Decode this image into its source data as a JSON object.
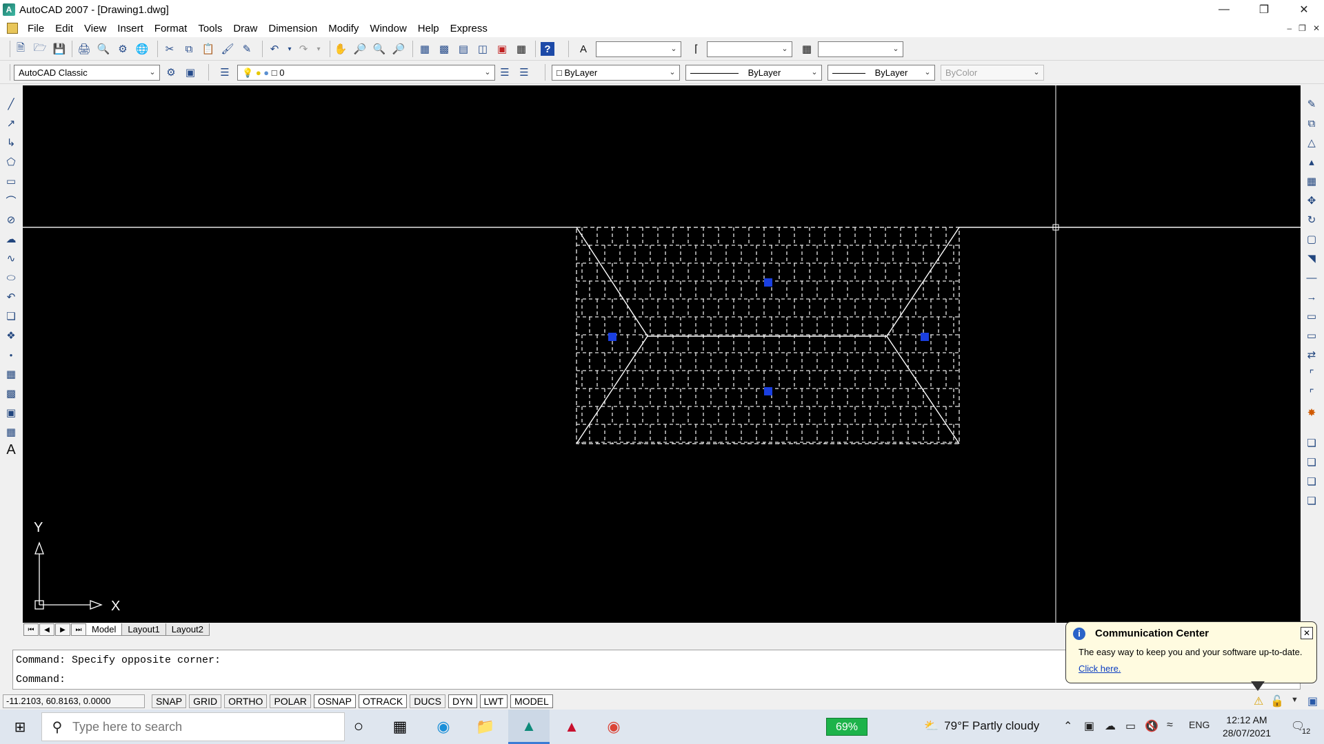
{
  "window": {
    "title": "AutoCAD 2007 - [Drawing1.dwg]",
    "minimize_icon": "minimize-icon",
    "restore_icon": "restore-icon",
    "close_icon": "close-icon"
  },
  "menu": {
    "items": [
      "File",
      "Edit",
      "View",
      "Insert",
      "Format",
      "Tools",
      "Draw",
      "Dimension",
      "Modify",
      "Window",
      "Help",
      "Express"
    ]
  },
  "toolbar2": {
    "workspace": "AutoCAD Classic",
    "layer": "0",
    "color": "ByLayer",
    "linetype": "ByLayer",
    "lineweight": "ByLayer",
    "plotstyle": "ByColor"
  },
  "tabs": {
    "items": [
      "Model",
      "Layout1",
      "Layout2"
    ],
    "active": "Model"
  },
  "command": {
    "line1": "Command: Specify opposite corner:",
    "line2": "Command:"
  },
  "status": {
    "coords": "-11.2103, 60.8163, 0.0000",
    "buttons": [
      "SNAP",
      "GRID",
      "ORTHO",
      "POLAR",
      "OSNAP",
      "OTRACK",
      "DUCS",
      "DYN",
      "LWT",
      "MODEL"
    ],
    "on": [
      "OSNAP",
      "OTRACK",
      "DYN",
      "LWT",
      "MODEL"
    ]
  },
  "comm_center": {
    "title": "Communication Center",
    "message": "The easy way to keep you and your software up-to-date.",
    "link": "Click here."
  },
  "ucs": {
    "x_label": "X",
    "y_label": "Y"
  },
  "taskbar": {
    "search_placeholder": "Type here to search",
    "battery": "69%",
    "weather": "79°F  Partly cloudy",
    "language": "ENG",
    "time": "12:12 AM",
    "date": "28/07/2021",
    "notifications": "12"
  }
}
